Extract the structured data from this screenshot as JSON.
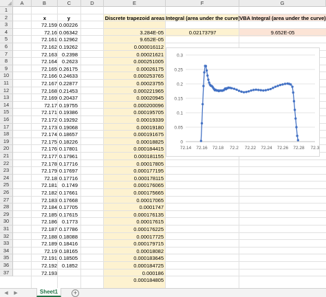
{
  "columns": [
    "A",
    "B",
    "C",
    "D",
    "E",
    "F",
    "G"
  ],
  "rows_visible": [
    "1",
    "2",
    "3",
    "4",
    "5",
    "6",
    "7",
    "8",
    "9",
    "10",
    "11",
    "12",
    "13",
    "14",
    "15",
    "16",
    "17",
    "18",
    "19",
    "20",
    "21",
    "22",
    "23",
    "24",
    "25",
    "26",
    "27",
    "28",
    "29",
    "30",
    "31",
    "32",
    "33",
    "34",
    "35",
    "36",
    "37"
  ],
  "header_row": {
    "x_label": "x",
    "y_label": "y",
    "discrete_label": "Discrete trapezoid areas",
    "integral_label": "Integral (area under the curve)",
    "vba_label": "VBA Integral (area under the curve)"
  },
  "results": {
    "integral_value": "0.02173797",
    "vba_value": "9.652E-05"
  },
  "x_values": [
    "72.159",
    "72.16",
    "72.161",
    "72.162",
    "72.163",
    "72.164",
    "72.165",
    "72.166",
    "72.167",
    "72.168",
    "72.169",
    "72.17",
    "72.171",
    "72.172",
    "72.173",
    "72.174",
    "72.175",
    "72.176",
    "72.177",
    "72.178",
    "72.179",
    "72.18",
    "72.181",
    "72.182",
    "72.183",
    "72.184",
    "72.185",
    "72.186",
    "72.187",
    "72.188",
    "72.189",
    "72.19",
    "72.191",
    "72.192",
    "72.193"
  ],
  "y_values": [
    "0.00226",
    "0.06342",
    "0.12962",
    "0.19262",
    "0.2398",
    "0.2623",
    "0.26175",
    "0.24633",
    "0.22877",
    "0.21453",
    "0.20437",
    "0.19755",
    "0.19386",
    "0.19292",
    "0.19068",
    "0.18657",
    "0.18226",
    "0.17801",
    "0.17961",
    "0.17716",
    "0.17697",
    "0.17716",
    "0.1749",
    "0.17661",
    "0.17668",
    "0.17705",
    "0.17615",
    "0.1773",
    "0.17786",
    "0.18088",
    "0.18416",
    "0.18165",
    "0.18505",
    "0.1852"
  ],
  "trapezoid_values": [
    "3.284E-05",
    "9.652E-05",
    "0.000016112",
    "0.00021621",
    "0.000251005",
    "0.00026175",
    "0.000253765",
    "0.00023755",
    "0.000221965",
    "0.00020945",
    "0.000200096",
    "0.000195705",
    "0.00019339",
    "0.00019180",
    "0.000191675",
    "0.00018825",
    "0.000184415",
    "0.000181155",
    "0.00017805",
    "0.000177195",
    "0.000178115",
    "0.000176065",
    "0.000175665",
    "0.00017065",
    "0.0001747",
    "0.000176135",
    "0.00017615",
    "0.000176225",
    "0.00017725",
    "0.000179715",
    "0.00018082",
    "0.000183645",
    "0.000184725",
    "0.000186",
    "0.000184805"
  ],
  "chart_data": {
    "type": "scatter",
    "mode": "lines+markers",
    "xlim": [
      72.14,
      72.3
    ],
    "ylim": [
      0,
      0.3
    ],
    "x_ticks": [
      "72.14",
      "72.16",
      "72.18",
      "72.2",
      "72.22",
      "72.24",
      "72.26",
      "72.28",
      "72.3"
    ],
    "y_ticks": [
      "0",
      "0.05",
      "0.1",
      "0.15",
      "0.2",
      "0.25",
      "0.3"
    ],
    "grid": "horizontal",
    "legend": "none",
    "color": "#4472C4",
    "x": [
      72.159,
      72.16,
      72.161,
      72.162,
      72.163,
      72.164,
      72.165,
      72.166,
      72.167,
      72.168,
      72.169,
      72.17,
      72.171,
      72.172,
      72.173,
      72.174,
      72.175,
      72.176,
      72.177,
      72.178,
      72.179,
      72.18,
      72.181,
      72.182,
      72.183,
      72.184,
      72.185,
      72.186,
      72.187,
      72.188,
      72.189,
      72.19,
      72.191,
      72.192,
      72.193,
      72.195,
      72.197,
      72.2,
      72.203,
      72.206,
      72.209,
      72.212,
      72.215,
      72.218,
      72.221,
      72.224,
      72.227,
      72.23,
      72.233,
      72.236,
      72.239,
      72.242,
      72.245,
      72.248,
      72.251,
      72.254,
      72.257,
      72.26,
      72.263,
      72.266,
      72.268,
      72.27,
      72.272,
      72.273,
      72.274,
      72.275,
      72.276,
      72.277,
      72.278,
      72.279
    ],
    "y": [
      0.00226,
      0.06342,
      0.12962,
      0.19262,
      0.2398,
      0.2623,
      0.26175,
      0.24633,
      0.22877,
      0.21453,
      0.20437,
      0.19755,
      0.19386,
      0.19292,
      0.19068,
      0.18657,
      0.18226,
      0.17801,
      0.17961,
      0.17716,
      0.17697,
      0.17716,
      0.1749,
      0.17661,
      0.17668,
      0.17705,
      0.17615,
      0.1773,
      0.17786,
      0.18088,
      0.18416,
      0.18165,
      0.18505,
      0.1852,
      0.187,
      0.186,
      0.185,
      0.183,
      0.18,
      0.176,
      0.173,
      0.171,
      0.172,
      0.174,
      0.177,
      0.179,
      0.18,
      0.179,
      0.178,
      0.177,
      0.178,
      0.18,
      0.182,
      0.186,
      0.19,
      0.193,
      0.196,
      0.198,
      0.2,
      0.201,
      0.2,
      0.198,
      0.19,
      0.17,
      0.14,
      0.11,
      0.08,
      0.05,
      0.02,
      0.005
    ]
  },
  "sheet_tab": "Sheet1",
  "icons": {
    "tab_prev": "triangle-left-icon",
    "tab_next": "triangle-right-icon",
    "add_sheet": "plus-circle-icon"
  }
}
